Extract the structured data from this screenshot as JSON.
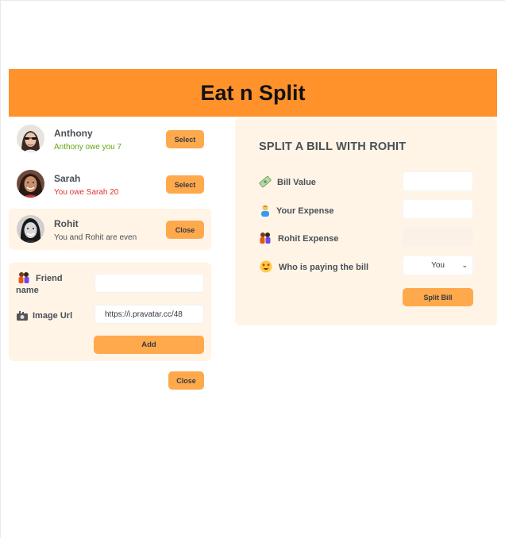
{
  "app": {
    "title": "Eat n Split"
  },
  "friends": [
    {
      "name": "Anthony",
      "status": "Anthony owe you 7",
      "button": "Select"
    },
    {
      "name": "Sarah",
      "status": "You owe Sarah 20",
      "button": "Select"
    },
    {
      "name": "Rohit",
      "status": "You and Rohit are even",
      "button": "Close"
    }
  ],
  "add_form": {
    "friend_name_label": "Friend name",
    "friend_name_value": "",
    "image_url_label": "Image Url",
    "image_url_value": "https://i.pravatar.cc/48",
    "add_label": "Add"
  },
  "close_label": "Close",
  "split_form": {
    "title": "SPLIT A BILL WITH ROHIT",
    "bill_value_label": "Bill Value",
    "bill_value": "",
    "your_expense_label": "Your Expense",
    "your_expense": "",
    "friend_expense_label": "Rohit Expense",
    "friend_expense": "",
    "payer_label": "Who is paying the bill",
    "payer_value": "You",
    "split_label": "Split Bill"
  },
  "colors": {
    "accent": "#ff922b",
    "button": "#ffa94d",
    "panel": "#fff4e6"
  }
}
